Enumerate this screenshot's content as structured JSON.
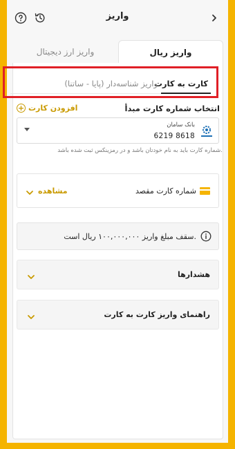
{
  "header": {
    "title": "واریز",
    "back_icon": "chevron-right-icon",
    "help_icon": "question-circle-icon",
    "history_icon": "history-icon"
  },
  "main_tabs": [
    {
      "label": "واریز ریال",
      "active": true
    },
    {
      "label": "واریز ارز دیجیتال",
      "active": false
    }
  ],
  "sub_tabs": [
    {
      "label": "کارت به کارت",
      "active": true
    },
    {
      "label": "واریز شناسه‌دار (پایا - ساتنا)",
      "active": false
    }
  ],
  "origin": {
    "label": "انتخاب شماره کارت مبدأ",
    "add_card_label": "افزودن کارت",
    "selected_card": {
      "bank_name": "بانک سامان",
      "number": "6219 8618"
    },
    "hint": "شماره کارت باید به نام خودتان باشد و در رمزینکس ثبت شده باشد."
  },
  "destination": {
    "label": "شماره کارت مقصد",
    "view_label": "مشاهده"
  },
  "limit": {
    "text": "سقف مبلغ واریز ۱۰۰,۰۰۰,۰۰۰ ریال است."
  },
  "accordions": [
    {
      "label": "هشدارها"
    },
    {
      "label": "راهنمای واریز کارت به کارت"
    }
  ],
  "colors": {
    "accent": "#F5B400",
    "link": "#C99A00",
    "highlight_border": "#E01F26"
  }
}
